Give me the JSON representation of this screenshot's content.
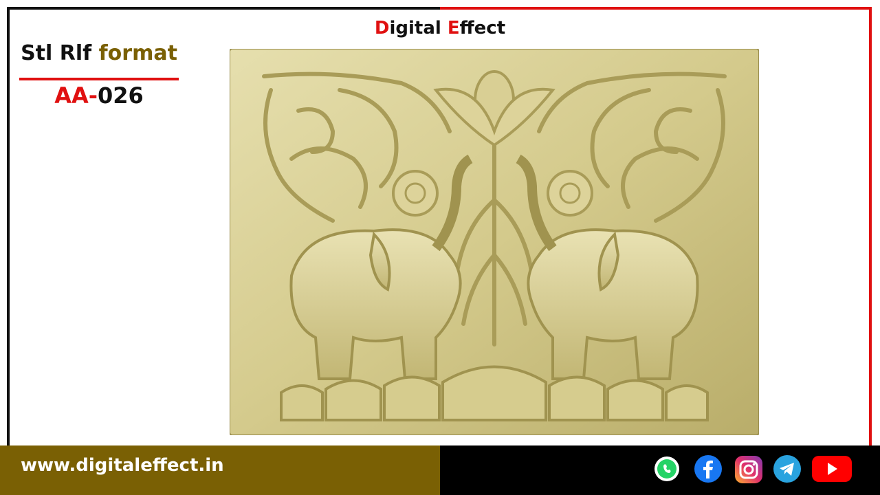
{
  "header": {
    "brand_first_letter": "D",
    "brand_rest1": "igital ",
    "brand_second_letter": "E",
    "brand_rest2": "ffect"
  },
  "product": {
    "format_prefix": "Stl Rlf ",
    "format_word": "format",
    "code_prefix": "AA-",
    "code_number": "026"
  },
  "footer": {
    "website": "www.digitaleffect.in"
  },
  "social_icons": [
    "whatsapp-icon",
    "facebook-icon",
    "instagram-icon",
    "telegram-icon",
    "youtube-icon"
  ],
  "colors": {
    "accent_red": "#e01010",
    "gold": "#7a6004",
    "panel": "#d8cf94"
  }
}
